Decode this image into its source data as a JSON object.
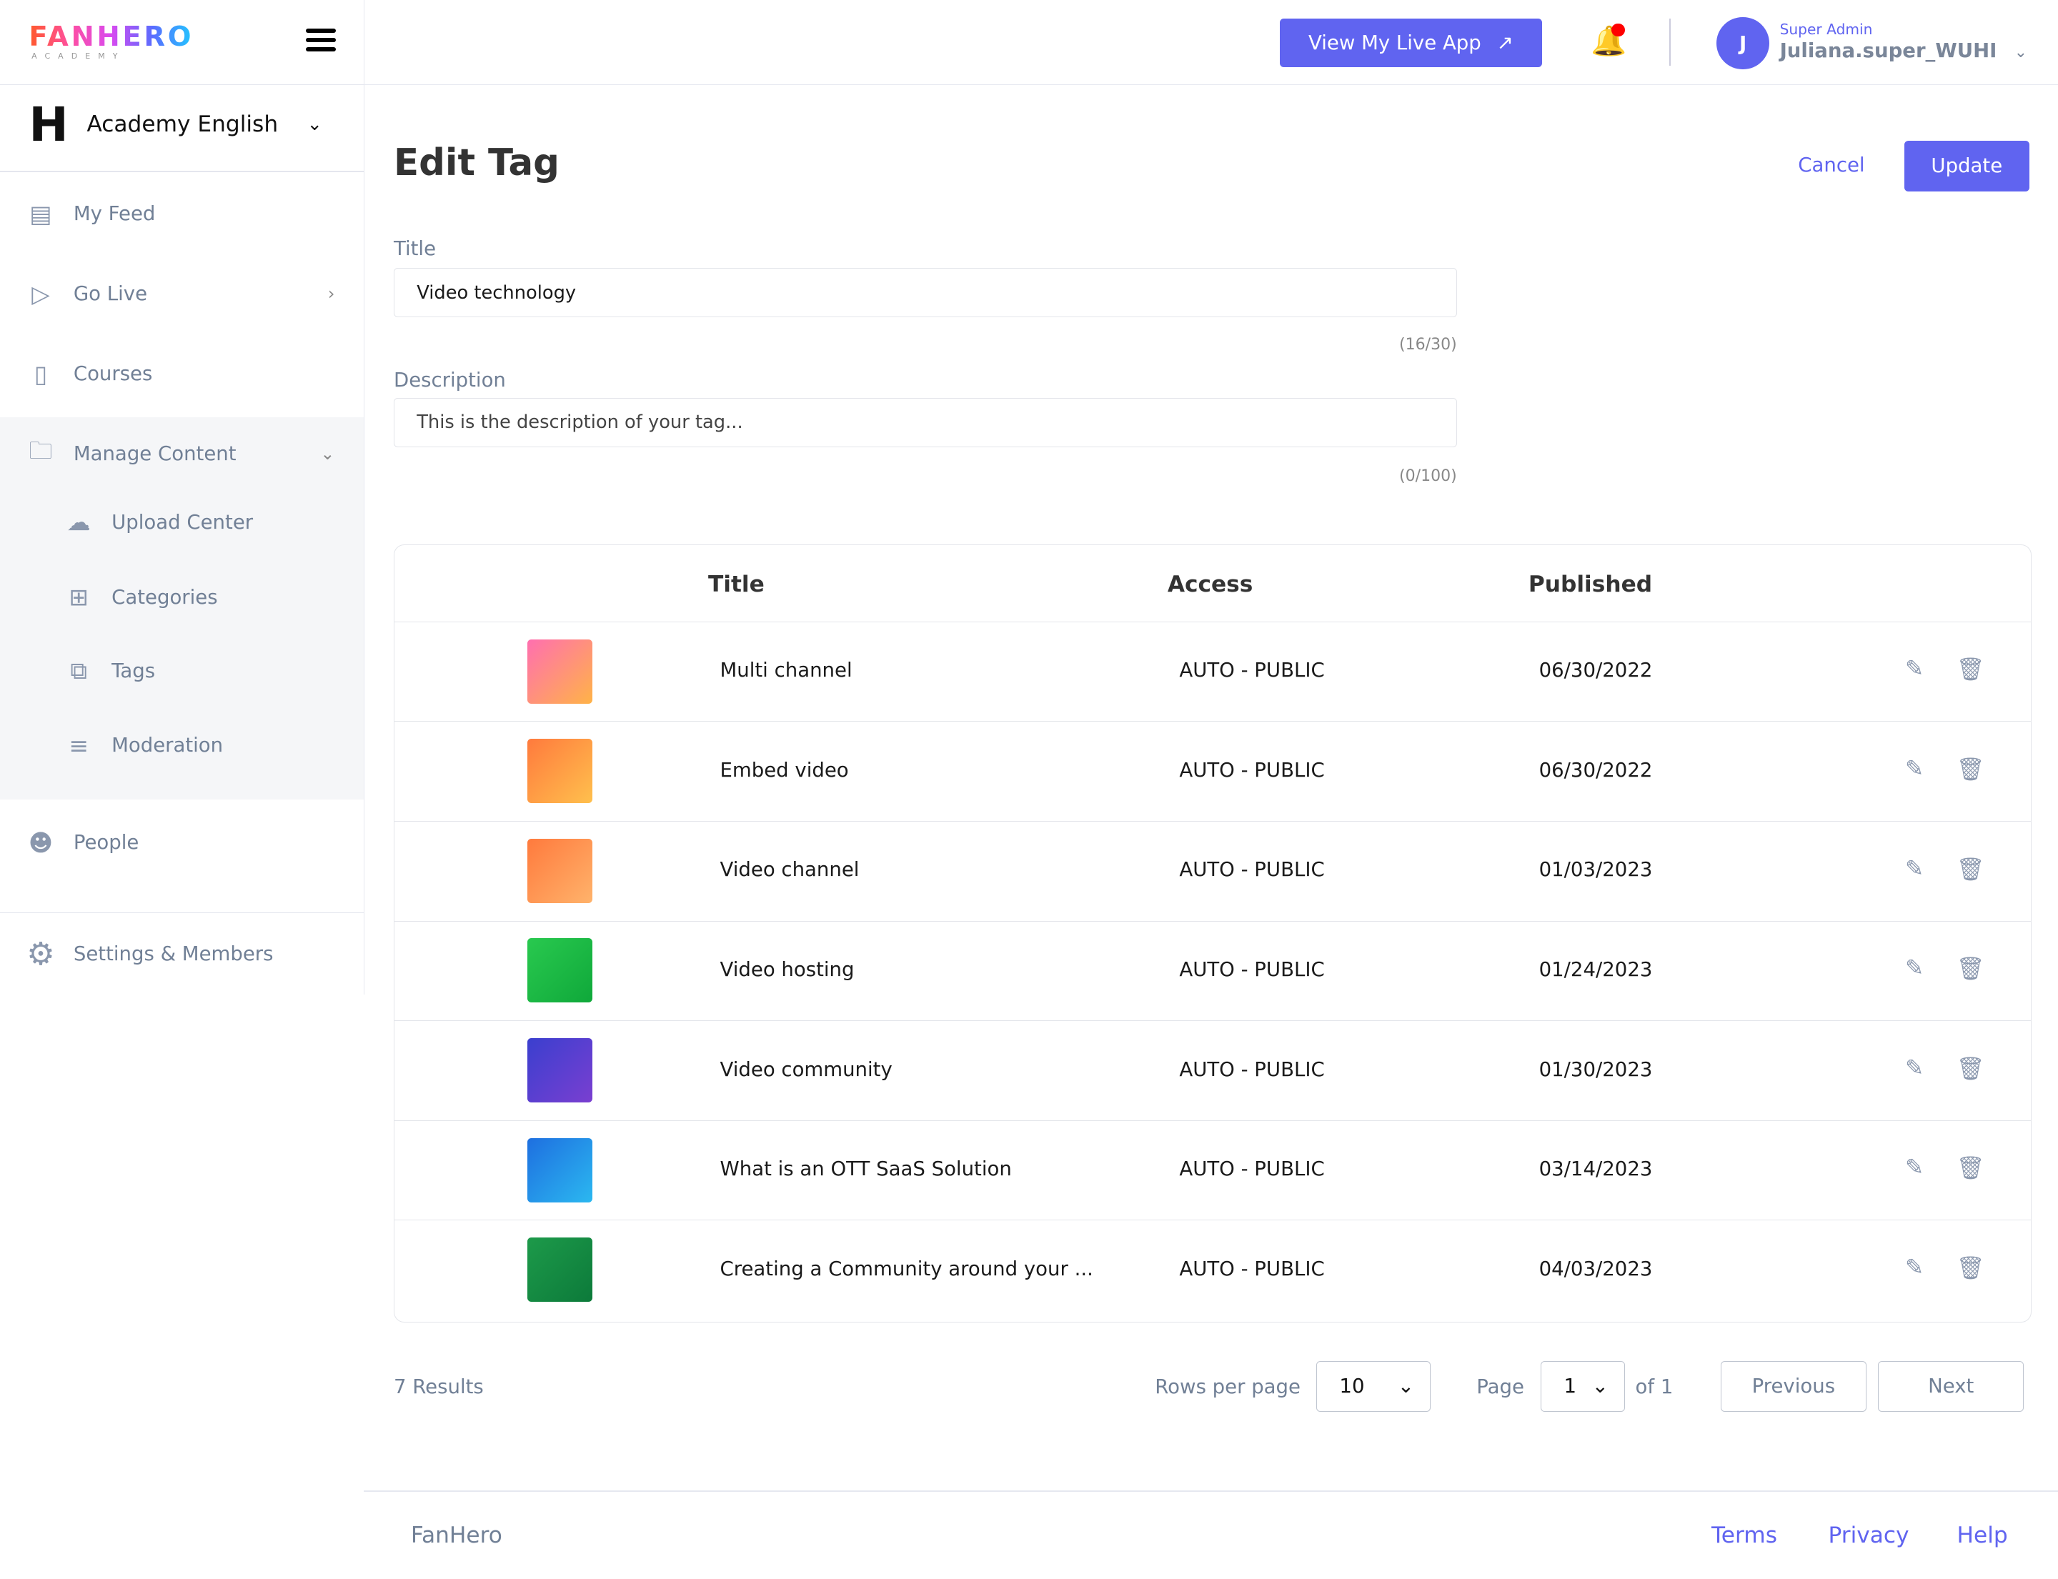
{
  "brand": {
    "logo": "FANHERO",
    "logo_sub": "ACADEMY",
    "org_name": "Academy English"
  },
  "header": {
    "live_button": "View My Live App",
    "user_role": "Super Admin",
    "user_name": "Juliana.super_WUHI",
    "avatar_initial": "J",
    "accent": "#6064f0",
    "notification_dot": "#ff0000"
  },
  "sidebar": {
    "items": [
      {
        "label": "My Feed",
        "icon": "feed-icon"
      },
      {
        "label": "Go Live",
        "icon": "live-icon"
      },
      {
        "label": "Courses",
        "icon": "book-icon"
      },
      {
        "label": "Manage Content",
        "icon": "folder-gear-icon"
      },
      {
        "label": "Upload Center",
        "icon": "cloud-upload-icon"
      },
      {
        "label": "Categories",
        "icon": "grid-icon"
      },
      {
        "label": "Tags",
        "icon": "tag-icon"
      },
      {
        "label": "Moderation",
        "icon": "sliders-icon"
      },
      {
        "label": "People",
        "icon": "people-icon"
      },
      {
        "label": "Settings & Members",
        "icon": "gear-icon"
      }
    ]
  },
  "page": {
    "title": "Edit Tag",
    "cancel": "Cancel",
    "update": "Update",
    "title_label": "Title",
    "title_value": "Video technology",
    "title_count": "(16/30)",
    "desc_label": "Description",
    "desc_placeholder": "This is the description of your tag...",
    "desc_count": "(0/100)"
  },
  "table": {
    "headers": [
      "Title",
      "Access",
      "Published"
    ],
    "rows": [
      {
        "title": "Multi channel",
        "access": "AUTO - PUBLIC",
        "published": "06/30/2022"
      },
      {
        "title": "Embed video",
        "access": "AUTO - PUBLIC",
        "published": "06/30/2022"
      },
      {
        "title": "Video channel",
        "access": "AUTO - PUBLIC",
        "published": "01/03/2023"
      },
      {
        "title": "Video hosting",
        "access": "AUTO - PUBLIC",
        "published": "01/24/2023"
      },
      {
        "title": "Video community",
        "access": "AUTO - PUBLIC",
        "published": "01/30/2023"
      },
      {
        "title": "What is an OTT SaaS Solution",
        "access": "AUTO - PUBLIC",
        "published": "03/14/2023"
      },
      {
        "title": "Creating a Community around your ...",
        "access": "AUTO - PUBLIC",
        "published": "04/03/2023"
      }
    ]
  },
  "pagination": {
    "results": "7 Results",
    "rows_label": "Rows per page",
    "rows_value": "10",
    "page_label": "Page",
    "page_value": "1",
    "of": "of 1",
    "previous": "Previous",
    "next": "Next"
  },
  "footer": {
    "brand": "FanHero",
    "terms": "Terms",
    "privacy": "Privacy",
    "help": "Help"
  }
}
